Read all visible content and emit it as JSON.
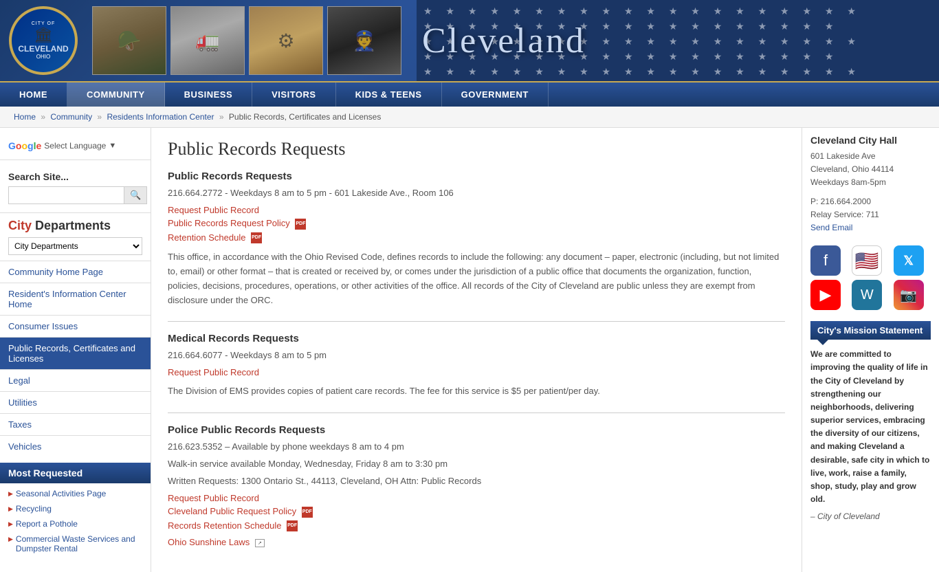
{
  "header": {
    "city_name": "Cleveland",
    "logo_alt": "City of Cleveland Ohio seal"
  },
  "nav": {
    "items": [
      {
        "label": "HOME",
        "active": false
      },
      {
        "label": "COMMUNITY",
        "active": true
      },
      {
        "label": "BUSINESS",
        "active": false
      },
      {
        "label": "VISITORS",
        "active": false
      },
      {
        "label": "KIDS & TEENS",
        "active": false
      },
      {
        "label": "GOVERNMENT",
        "active": false
      }
    ]
  },
  "breadcrumb": {
    "items": [
      {
        "label": "Home",
        "href": "#"
      },
      {
        "label": "Community",
        "href": "#"
      },
      {
        "label": "Residents Information Center",
        "href": "#"
      },
      {
        "label": "Public Records, Certificates and Licenses",
        "href": "#"
      }
    ]
  },
  "sidebar": {
    "translate_label": "Select Language",
    "search_label": "Search Site...",
    "search_placeholder": "",
    "city_dept_heading_city": "City",
    "city_dept_heading_rest": " Departments",
    "dept_select_default": "City Departments",
    "nav_items": [
      {
        "label": "Community Home Page",
        "active": false
      },
      {
        "label": "Resident's Information Center Home",
        "active": false
      },
      {
        "label": "Consumer Issues",
        "active": false
      },
      {
        "label": "Public Records, Certificates and Licenses",
        "active": true
      },
      {
        "label": "Legal",
        "active": false
      },
      {
        "label": "Utilities",
        "active": false
      },
      {
        "label": "Taxes",
        "active": false
      },
      {
        "label": "Vehicles",
        "active": false
      }
    ],
    "most_requested_label": "Most Requested",
    "most_req_items": [
      {
        "label": "Seasonal Activities Page"
      },
      {
        "label": "Recycling"
      },
      {
        "label": "Report a Pothole"
      },
      {
        "label": "Commercial Waste Services and Dumpster Rental"
      }
    ]
  },
  "main": {
    "page_title": "Public Records Requests",
    "sections": [
      {
        "id": "public",
        "heading": "Public Records Requests",
        "phone_info": "216.664.2772 - Weekdays 8 am to 5 pm - 601 Lakeside Ave., Room 106",
        "links": [
          {
            "label": "Request Public Record",
            "pdf": false
          },
          {
            "label": "Public Records Request Policy",
            "pdf": true
          },
          {
            "label": "Retention Schedule",
            "pdf": true
          }
        ],
        "body": "This office, in accordance with the Ohio Revised Code, defines records to include the following: any document – paper, electronic (including, but not limited to, email) or other format – that is created or received by, or comes under the jurisdiction of a public office that documents the organization, function, policies, decisions, procedures, operations, or other activities of the office. All records of the City of Cleveland are public unless they are exempt from disclosure under the ORC."
      },
      {
        "id": "medical",
        "heading": "Medical Records Requests",
        "phone_info": "216.664.6077 - Weekdays 8 am to 5 pm",
        "links": [
          {
            "label": "Request Public Record",
            "pdf": false
          }
        ],
        "body": "The Division of EMS provides copies of patient care records. The fee for this service is $5 per patient/per day."
      },
      {
        "id": "police",
        "heading": "Police Public Records Requests",
        "phone_info": "216.623.5352 – Available by phone weekdays 8 am to 4 pm",
        "phone_info2": "Walk-in service available Monday, Wednesday, Friday 8 am to 3:30 pm",
        "phone_info3": "Written Requests: 1300 Ontario St., 44113, Cleveland, OH Attn: Public Records",
        "links": [
          {
            "label": "Request Public Record",
            "pdf": false
          },
          {
            "label": "Cleveland Public Request Policy",
            "pdf": true
          },
          {
            "label": "Records Retention Schedule",
            "pdf": true
          }
        ],
        "extra_link": {
          "label": "Ohio Sunshine Laws",
          "ext": true
        }
      }
    ]
  },
  "right_sidebar": {
    "city_hall_name": "Cleveland City Hall",
    "city_hall_address": "601 Lakeside Ave",
    "city_hall_city": "Cleveland, Ohio 44114",
    "city_hall_hours": "Weekdays 8am-5pm",
    "phone_label": "P: 216.664.2000",
    "relay_label": "Relay Service: 711",
    "email_label": "Send Email",
    "social_items": [
      {
        "name": "facebook",
        "icon": "f",
        "label": "Facebook"
      },
      {
        "name": "american-flag",
        "icon": "🇺🇸",
        "label": "American Flag"
      },
      {
        "name": "twitter",
        "icon": "𝕏",
        "label": "Twitter"
      },
      {
        "name": "youtube",
        "icon": "▶",
        "label": "YouTube"
      },
      {
        "name": "wordpress",
        "icon": "W",
        "label": "WordPress"
      },
      {
        "name": "instagram",
        "icon": "📷",
        "label": "Instagram"
      }
    ],
    "mission_label": "City's Mission Statement",
    "mission_text": "We are committed to improving the quality of life in the City of Cleveland by strengthening our neighborhoods, delivering superior services, embracing the diversity of our citizens, and making Cleveland a desirable, safe city in which to live, work, raise a family, shop, study, play and grow old.",
    "mission_credit": "– City of Cleveland"
  }
}
